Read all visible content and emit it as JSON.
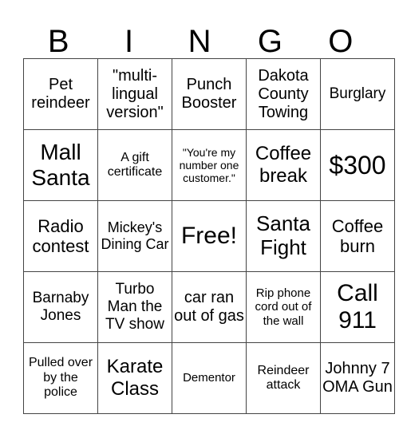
{
  "header": {
    "letters": [
      "B",
      "I",
      "N",
      "G",
      "O"
    ]
  },
  "rows": [
    [
      "Pet reindeer",
      "\"multi-lingual version\"",
      "Punch Booster",
      "Dakota County Towing",
      "Burglary"
    ],
    [
      "Mall Santa",
      "A gift certificate",
      "\"You're my number one customer.\"",
      "Coffee break",
      "$300"
    ],
    [
      "Radio contest",
      "Mickey's Dining Car",
      "Free!",
      "Santa Fight",
      "Coffee burn"
    ],
    [
      "Barnaby Jones",
      "Turbo Man the TV show",
      "car ran out of gas",
      "Rip phone cord out of the wall",
      "Call 911"
    ],
    [
      "Pulled over by the police",
      "Karate Class",
      "Dementor",
      "Reindeer attack",
      "Johnny 7 OMA Gun"
    ]
  ]
}
